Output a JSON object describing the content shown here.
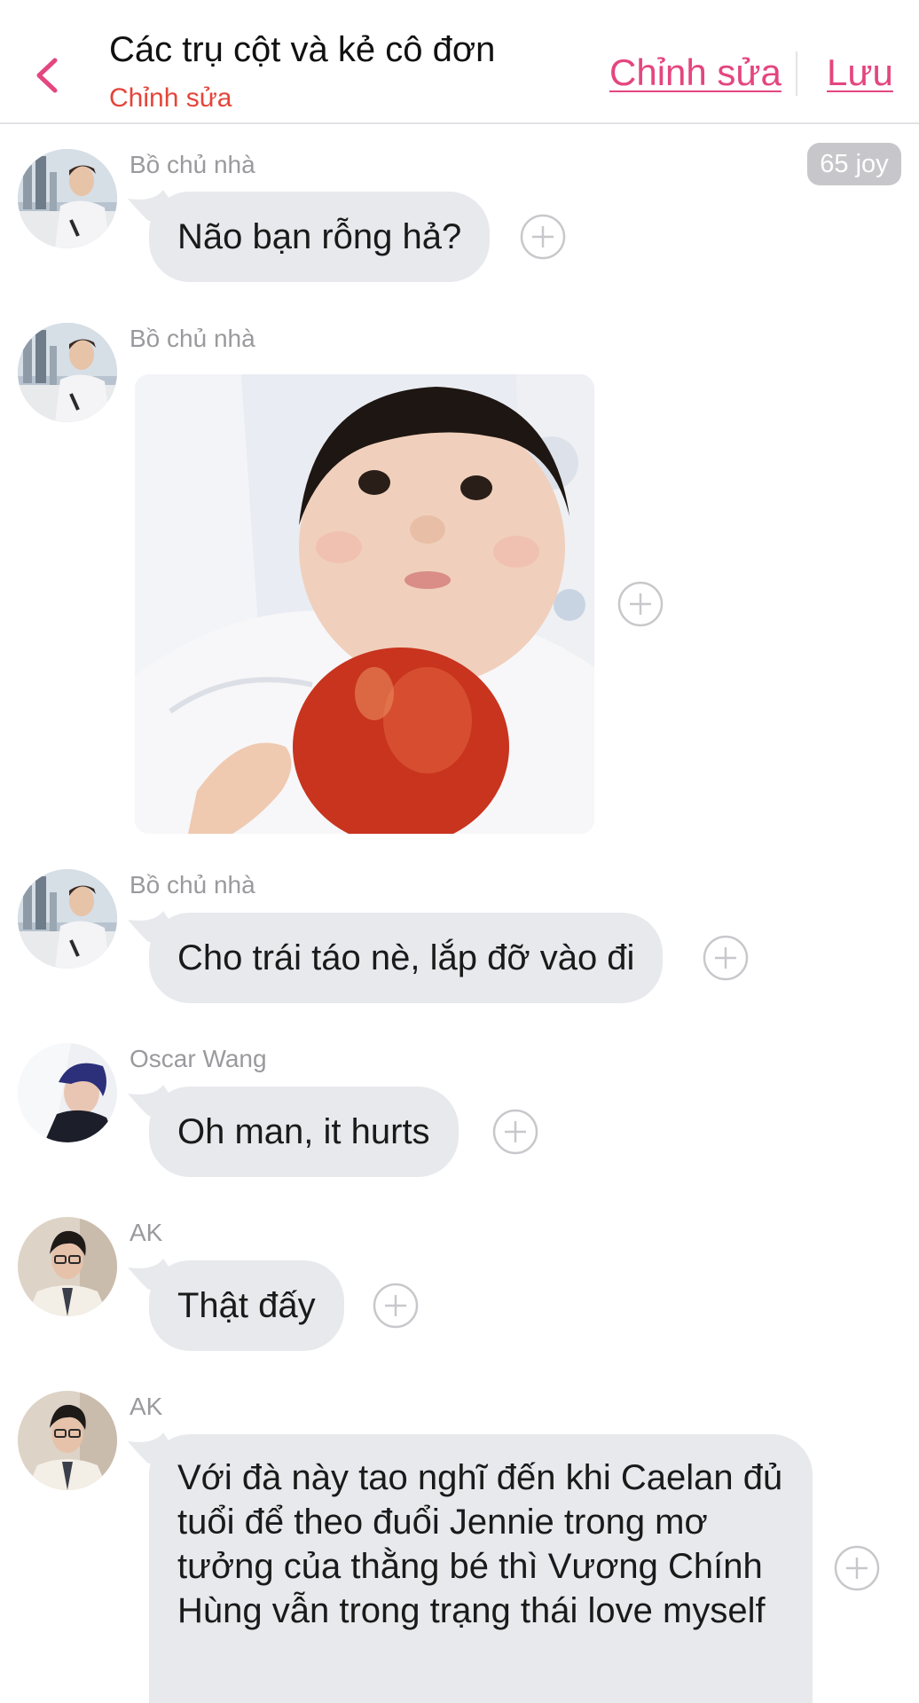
{
  "header": {
    "title": "Các trụ cột và kẻ cô đơn",
    "subtitle": "Chỉnh sửa",
    "edit_label": "Chỉnh sửa",
    "save_label": "Lưu"
  },
  "badge": {
    "label": "65 joy"
  },
  "messages": [
    {
      "sender": "Bồ chủ nhà",
      "text": "Não bạn rỗng hả?"
    },
    {
      "sender": "Bồ chủ nhà",
      "type": "image"
    },
    {
      "sender": "Bồ chủ nhà",
      "text": "Cho trái táo nè, lắp đỡ vào đi"
    },
    {
      "sender": "Oscar Wang",
      "text": "Oh man, it hurts"
    },
    {
      "sender": "AK",
      "text": "Thật đấy"
    },
    {
      "sender": "AK",
      "text": "Với đà này tao nghĩ đến khi Caelan đủ tuổi để theo đuổi Jennie trong mơ tưởng của thằng bé thì Vương Chính Hùng vẫn trong trạng thái love myself"
    }
  ],
  "colors": {
    "accent": "#e4467f",
    "subtitle": "#e5453a",
    "bubble": "#e8e9ed",
    "sender": "#9a9a9e",
    "badge": "#c7c7cb"
  },
  "icons": {
    "back": "chevron-left-icon",
    "add": "plus-circle-icon"
  }
}
